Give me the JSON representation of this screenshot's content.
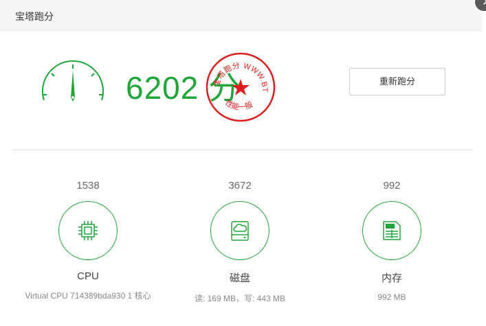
{
  "window": {
    "title": "宝塔跑分"
  },
  "score": {
    "value": "6202",
    "unit": "分"
  },
  "stamp": {
    "top_text": "宝塔跑分 WWW.BT.CN",
    "bottom_text": "性能一般",
    "color": "#e01b1b"
  },
  "actions": {
    "rerun_label": "重新跑分"
  },
  "metrics": [
    {
      "score": "1538",
      "name": "CPU",
      "detail": "Virtual CPU 714389bda930 1 核心",
      "icon": "cpu-icon"
    },
    {
      "score": "3672",
      "name": "磁盘",
      "detail": "读: 169 MB，写: 443 MB",
      "icon": "disk-cloud-icon"
    },
    {
      "score": "992",
      "name": "内存",
      "detail": "992 MB",
      "icon": "memory-icon"
    }
  ],
  "colors": {
    "accent": "#20a53a",
    "stamp_red": "#e01b1b"
  }
}
